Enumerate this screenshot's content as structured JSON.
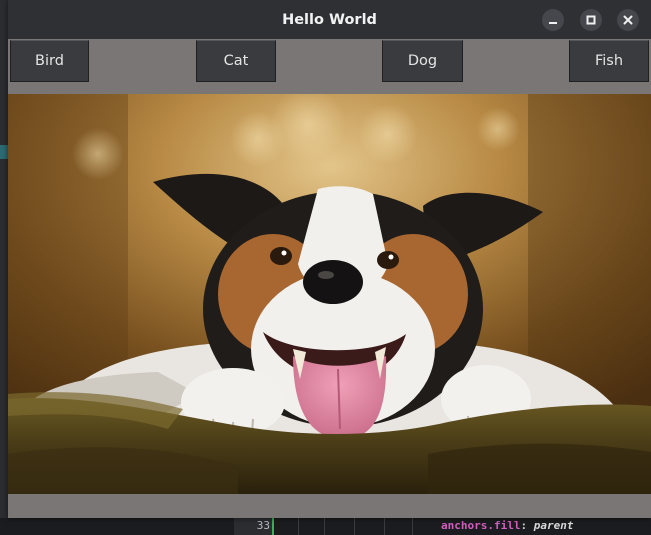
{
  "window": {
    "title": "Hello World",
    "controls": [
      {
        "name": "minimize-button",
        "icon": "minimize-icon"
      },
      {
        "name": "maximize-button",
        "icon": "maximize-icon"
      },
      {
        "name": "close-button",
        "icon": "close-icon"
      }
    ]
  },
  "toolbar": {
    "buttons": [
      {
        "label": "Bird"
      },
      {
        "label": "Cat"
      },
      {
        "label": "Dog"
      },
      {
        "label": "Fish"
      }
    ]
  },
  "image": {
    "icon": "dog-photo"
  },
  "background_editor": {
    "line_number": "33",
    "code_property": "anchors.fill",
    "code_colon": ":",
    "code_value": "parent"
  },
  "colors": {
    "titlebar": "#2f3034",
    "window_body": "#7a7676",
    "button": "#3a3b3e",
    "code_property": "#d45ec0"
  }
}
